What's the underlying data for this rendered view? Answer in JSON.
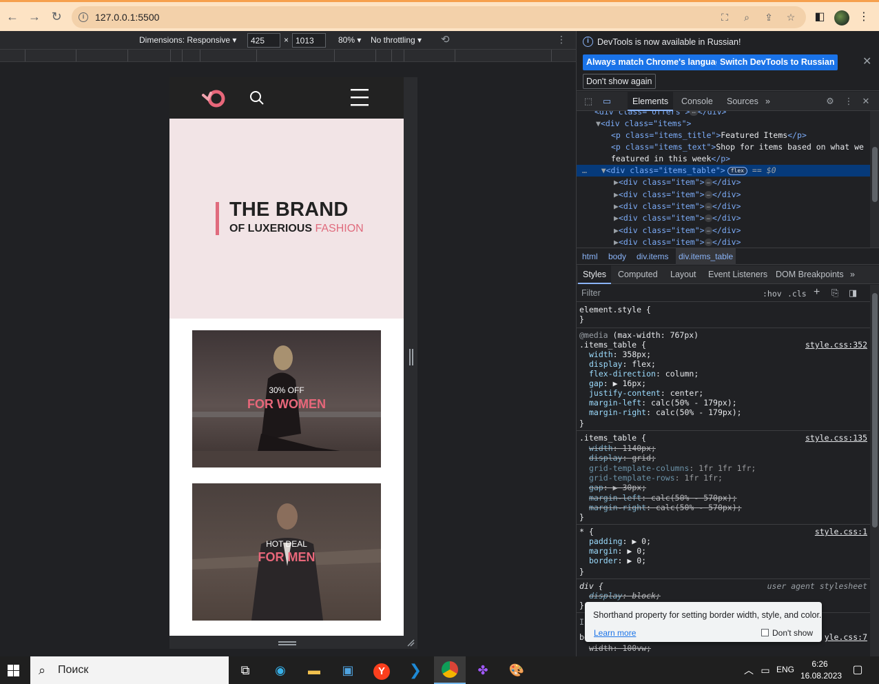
{
  "browser": {
    "url": "127.0.0.1:5500",
    "back_icon": "arrow-left-icon",
    "forward_icon": "arrow-right-icon",
    "reload_icon": "reload-icon"
  },
  "device_toolbar": {
    "dimensions_label": "Dimensions: Responsive",
    "width": "425",
    "times": "×",
    "height": "1013",
    "zoom": "80%",
    "throttling": "No throttling"
  },
  "site": {
    "hero_title": "THE BRAND",
    "hero_sub_a": "OF LUXERIOUS",
    "hero_sub_b": "FASHION",
    "cards": [
      {
        "small": "30% OFF",
        "big": "FOR WOMEN"
      },
      {
        "small": "HOT DEAL",
        "big": "FOR MEN"
      }
    ]
  },
  "devtools": {
    "info_message": "DevTools is now available in Russian!",
    "btn_match": "Always match Chrome's language",
    "btn_switch": "Switch DevTools to Russian",
    "btn_dont_show": "Don't show again",
    "tabs": [
      "Elements",
      "Console",
      "Sources"
    ],
    "more_tabs": "»",
    "dom": {
      "l0_tag": "<div class=\"offers\">",
      "l0_end": "</div>",
      "l1": "<div class=\"items\">",
      "l2_open": "<p class=\"items_title\">",
      "l2_text": "Featured Items",
      "l2_close": "</p>",
      "l3_open": "<p class=\"items_text\">",
      "l3_text": "Shop for items based on what we",
      "l3b_text": "featured in this week",
      "l3_close": "</p>",
      "sel_tag": "<div class=\"items_table\">",
      "sel_badge": "flex",
      "sel_eq": "== $0",
      "item_open": "<div class=\"item\">",
      "item_close": "</div>",
      "ellipsis": "…"
    },
    "breadcrumbs": [
      "html",
      "body",
      "div.items",
      "div.items_table"
    ],
    "style_tabs": [
      "Styles",
      "Computed",
      "Layout",
      "Event Listeners",
      "DOM Breakpoints"
    ],
    "filter_placeholder": "Filter",
    "hov": ":hov",
    "cls": ".cls",
    "styles": {
      "element_style": "element.style {",
      "close_brace": "}",
      "media_kw": "@media",
      "media_rest": "(max-width: 767px)",
      "rule1_sel": ".items_table {",
      "rule1_src": "style.css:352",
      "rule1": [
        {
          "p": "width",
          "v": "358px;"
        },
        {
          "p": "display",
          "v": "flex;"
        },
        {
          "p": "flex-direction",
          "v": "column;"
        },
        {
          "p": "gap",
          "v": "▶ 16px;"
        },
        {
          "p": "justify-content",
          "v": "center;"
        },
        {
          "p": "margin-left",
          "v": "calc(50% - 179px);"
        },
        {
          "p": "margin-right",
          "v": "calc(50% - 179px);"
        }
      ],
      "rule2_sel": ".items_table {",
      "rule2_src": "style.css:135",
      "rule2": [
        {
          "p": "width",
          "v": "1140px;"
        },
        {
          "p": "display",
          "v": "grid;"
        },
        {
          "p": "grid-template-columns",
          "v": "1fr 1fr 1fr;"
        },
        {
          "p": "grid-template-rows",
          "v": "1fr 1fr;"
        },
        {
          "p": "gap",
          "v": "▶ 30px;"
        },
        {
          "p": "margin-left",
          "v": "calc(50% - 570px);"
        },
        {
          "p": "margin-right",
          "v": "calc(50% - 570px);"
        }
      ],
      "rule3_sel": "* {",
      "rule3_src": "style.css:1",
      "rule3": [
        {
          "p": "padding",
          "v": "▶ 0;"
        },
        {
          "p": "margin",
          "v": "▶ 0;"
        },
        {
          "p": "border",
          "v": "▶ 0;"
        }
      ],
      "rule4_sel": "div {",
      "rule4_src": "user agent stylesheet",
      "rule4_p": "display",
      "rule4_v": "block;",
      "tail_a": "In",
      "tail_b": "bo",
      "tail_src": "yle.css:7",
      "tail_line": "width: 100vw;"
    },
    "tooltip": {
      "text": "Shorthand property for setting border width, style, and color.",
      "learn_more": "Learn more",
      "dont_show": "Don't show"
    }
  },
  "taskbar": {
    "search_placeholder": "Поиск",
    "lang": "ENG",
    "time": "6:26",
    "date": "16.08.2023"
  }
}
